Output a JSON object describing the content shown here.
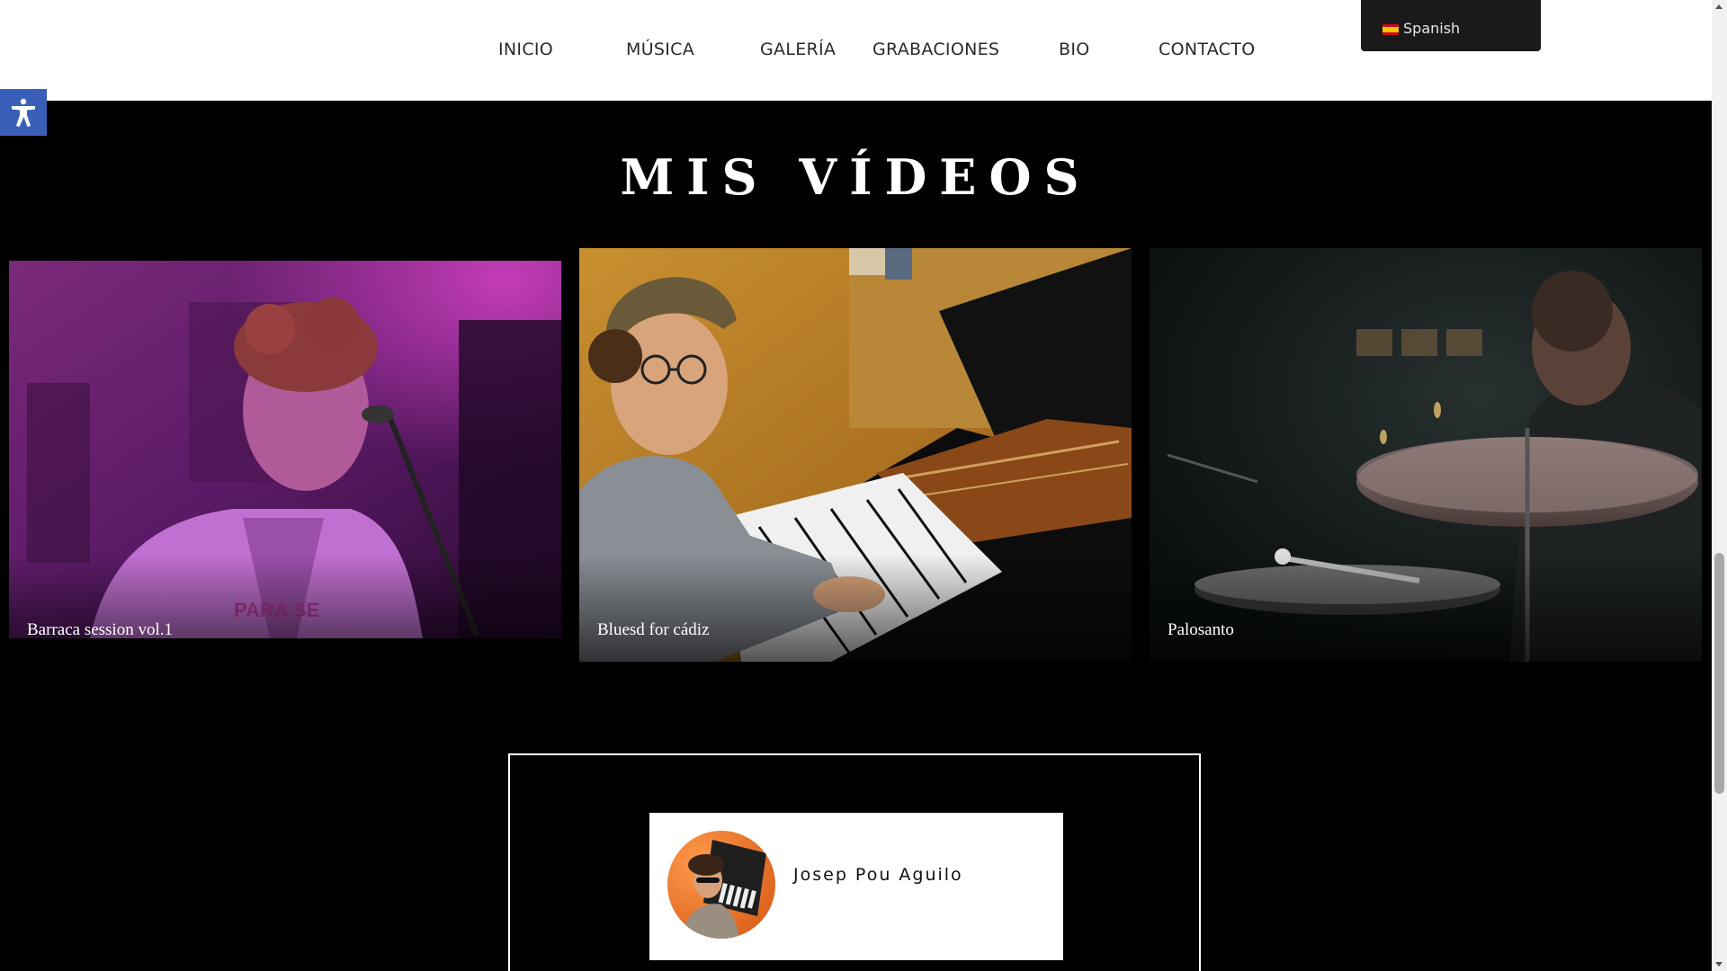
{
  "nav": {
    "items": [
      {
        "label": "INICIO"
      },
      {
        "label": "MÚSICA"
      },
      {
        "label": "GALERÍA"
      },
      {
        "label": "GRABACIONES"
      },
      {
        "label": "BIO"
      },
      {
        "label": "CONTACTO"
      }
    ]
  },
  "language": {
    "label": "Spanish",
    "flag_icon": "spain-flag-icon"
  },
  "accessibility": {
    "icon": "accessibility-icon",
    "color": "#3a5fb8"
  },
  "videos": {
    "title": "MIS VÍDEOS",
    "items": [
      {
        "caption": "Barraca session vol.1"
      },
      {
        "caption": "Bluesd for cádiz"
      },
      {
        "caption": "Palosanto"
      }
    ]
  },
  "profile": {
    "name": "Josep Pou Aguilo"
  },
  "colors": {
    "background": "#000000",
    "header": "#ffffff",
    "language_switcher": "#1a1a1a"
  }
}
